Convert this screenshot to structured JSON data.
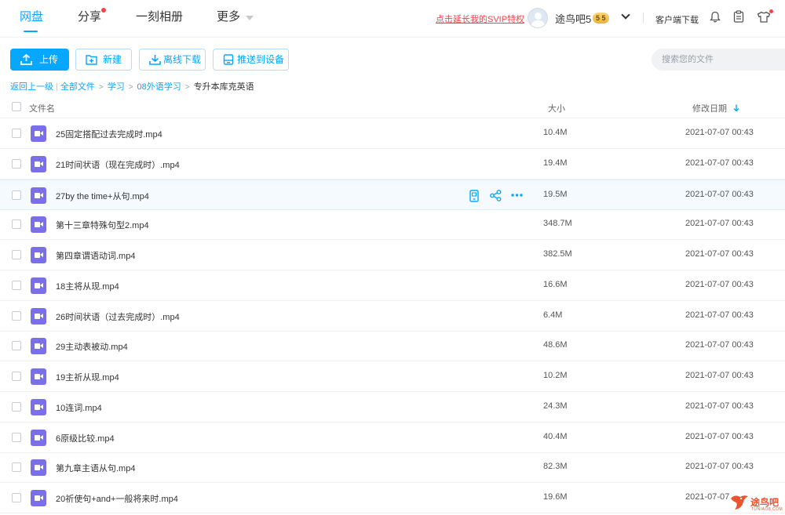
{
  "nav": {
    "items": [
      "网盘",
      "分享",
      "一刻相册",
      "更多"
    ],
    "svip_link": "点击延长我的SVIP特权",
    "username": "途鸟吧5",
    "vip_badge": "5",
    "client_download": "客户端下载"
  },
  "toolbar": {
    "upload": "上传",
    "new": "新建",
    "offline_download": "离线下载",
    "push_to_device": "推送到设备",
    "search_placeholder": "搜索您的文件"
  },
  "breadcrumb": {
    "back": "返回上一级",
    "all_files": "全部文件",
    "path": [
      "学习",
      "08外语学习"
    ],
    "current": "专升本库克英语"
  },
  "table": {
    "col_name": "文件名",
    "col_size": "大小",
    "col_modified": "修改日期",
    "rows": [
      {
        "name": "25固定搭配过去完成时.mp4",
        "size": "10.4M",
        "date": "2021-07-07 00:43"
      },
      {
        "name": "21时间状语（现在完成时）.mp4",
        "size": "19.4M",
        "date": "2021-07-07 00:43"
      },
      {
        "name": "27by the time+从句.mp4",
        "size": "19.5M",
        "date": "2021-07-07 00:43"
      },
      {
        "name": "第十三章特殊句型2.mp4",
        "size": "348.7M",
        "date": "2021-07-07 00:43"
      },
      {
        "name": "第四章谓语动词.mp4",
        "size": "382.5M",
        "date": "2021-07-07 00:43"
      },
      {
        "name": "18主将从现.mp4",
        "size": "16.6M",
        "date": "2021-07-07 00:43"
      },
      {
        "name": "26时间状语（过去完成时）.mp4",
        "size": "6.4M",
        "date": "2021-07-07 00:43"
      },
      {
        "name": "29主动表被动.mp4",
        "size": "48.6M",
        "date": "2021-07-07 00:43"
      },
      {
        "name": "19主祈从现.mp4",
        "size": "10.2M",
        "date": "2021-07-07 00:43"
      },
      {
        "name": "10连词.mp4",
        "size": "24.3M",
        "date": "2021-07-07 00:43"
      },
      {
        "name": "6原级比较.mp4",
        "size": "40.4M",
        "date": "2021-07-07 00:43"
      },
      {
        "name": "第九章主语从句.mp4",
        "size": "82.3M",
        "date": "2021-07-07 00:43"
      },
      {
        "name": "20祈使句+and+一般将来时.mp4",
        "size": "19.6M",
        "date": "2021-07-07"
      }
    ]
  },
  "watermark": {
    "text": "途鸟吧",
    "sub": "TUNIAO8.COM"
  },
  "colors": {
    "accent": "#06a7ff",
    "danger": "#f5424b",
    "video_icon": "#7a6fe8"
  }
}
